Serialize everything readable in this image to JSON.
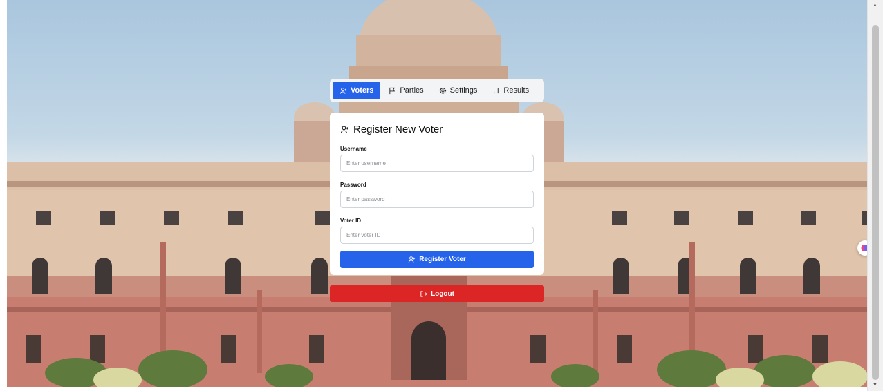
{
  "tabs": [
    {
      "label": "Voters",
      "icon": "user-plus-icon",
      "active": true
    },
    {
      "label": "Parties",
      "icon": "flag-icon",
      "active": false
    },
    {
      "label": "Settings",
      "icon": "gear-icon",
      "active": false
    },
    {
      "label": "Results",
      "icon": "bar-chart-icon",
      "active": false
    }
  ],
  "card": {
    "title": "Register New Voter",
    "fields": [
      {
        "label": "Username",
        "placeholder": "Enter username",
        "value": ""
      },
      {
        "label": "Password",
        "placeholder": "Enter password",
        "value": ""
      },
      {
        "label": "Voter ID",
        "placeholder": "Enter voter ID",
        "value": ""
      }
    ],
    "submit_label": "Register Voter"
  },
  "logout_label": "Logout",
  "colors": {
    "primary": "#2563eb",
    "danger": "#dc2626",
    "card_bg": "#ffffff",
    "tabs_bg": "#f3f4f6"
  }
}
